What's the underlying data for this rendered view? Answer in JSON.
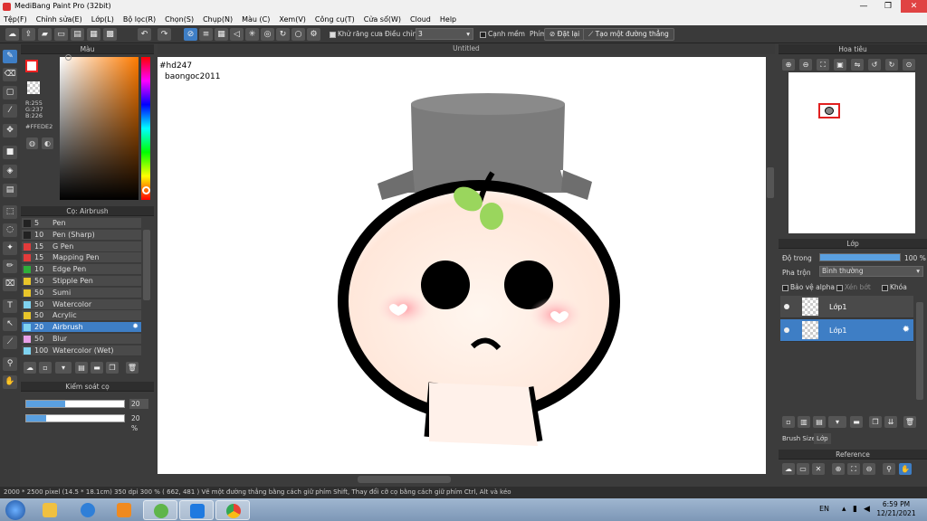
{
  "window": {
    "title": "MediBang Paint Pro (32bit)",
    "minimize": "—",
    "maximize": "❐",
    "close": "✕"
  },
  "menu": [
    "Tệp(F)",
    "Chỉnh sửa(E)",
    "Lớp(L)",
    "Bộ lọc(R)",
    "Chọn(S)",
    "Chụp(N)",
    "Màu (C)",
    "Xem(V)",
    "Công cụ(T)",
    "Cửa sổ(W)",
    "Cloud",
    "Help"
  ],
  "toolbar": {
    "antialias_label": "Khử răng cưa",
    "adjust_label": "Điều chỉnh",
    "adjust_value": "3",
    "snap_label": "Cạnh mềm",
    "key_label": "Phím",
    "reset_label": "Đặt lại",
    "straight_line_label": "Tạo một đường thẳng"
  },
  "color_panel": {
    "title": "Màu",
    "r": "R:255",
    "g": "G:237",
    "b": "B:226",
    "hex": "#FFEDE2",
    "fg_color": "#ffffff"
  },
  "brush_panel": {
    "title": "Cọ: Airbrush",
    "brushes": [
      {
        "size": "5",
        "name": "Pen",
        "color": "#222222"
      },
      {
        "size": "10",
        "name": "Pen (Sharp)",
        "color": "#222222"
      },
      {
        "size": "15",
        "name": "G Pen",
        "color": "#e23b3b"
      },
      {
        "size": "15",
        "name": "Mapping Pen",
        "color": "#e23b3b"
      },
      {
        "size": "10",
        "name": "Edge Pen",
        "color": "#2fae3a"
      },
      {
        "size": "50",
        "name": "Stipple Pen",
        "color": "#e8c52a"
      },
      {
        "size": "50",
        "name": "Sumi",
        "color": "#e8c52a"
      },
      {
        "size": "50",
        "name": "Watercolor",
        "color": "#7fd3f0"
      },
      {
        "size": "50",
        "name": "Acrylic",
        "color": "#e8c52a"
      },
      {
        "size": "20",
        "name": "Airbrush",
        "color": "#7fd3f0"
      },
      {
        "size": "50",
        "name": "Blur",
        "color": "#e8a0e8"
      },
      {
        "size": "100",
        "name": "Watercolor (Wet)",
        "color": "#7fd3f0"
      }
    ]
  },
  "brush_control": {
    "title": "Kiểm soát cọ",
    "size_value": "20",
    "opacity_value": "20 %",
    "size_fraction": 0.4,
    "opacity_fraction": 0.2
  },
  "canvas": {
    "tab_title": "Untitled",
    "note1": "#hd247",
    "note2": "baongoc2011"
  },
  "navigator": {
    "title": "Hoa tiêu"
  },
  "layer_panel": {
    "title": "Lớp",
    "opacity_label": "Độ trong",
    "opacity_value": "100 %",
    "opacity_fraction": 1.0,
    "blend_label": "Pha trộn",
    "blend_value": "Bình thường",
    "protect_alpha": "Bảo vệ alpha",
    "clipping": "Xén bớt",
    "lock": "Khóa",
    "layers": [
      "Lớp1",
      "Lớp1"
    ],
    "tab_brush_size": "Brush Size",
    "tab_layer": "Lớp"
  },
  "reference": {
    "title": "Reference"
  },
  "status": {
    "text": "2000 * 2500 pixel   (14.5 * 18.1cm)   350 dpi   300 %   ( 662, 481 )  Vẽ một đường thẳng bằng cách giữ phím Shift, Thay đổi cỡ cọ bằng cách giữ phím Ctrl, Alt và kéo"
  },
  "taskbar": {
    "lang": "EN",
    "time": "6:59 PM",
    "date": "12/21/2021"
  }
}
